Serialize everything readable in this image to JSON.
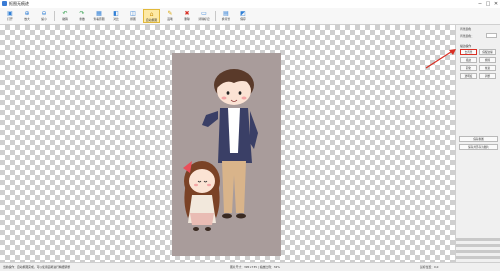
{
  "window": {
    "title": "抠图无痕迹",
    "minimize": "─",
    "maximize": "□",
    "close": "✕"
  },
  "toolbar": {
    "buttons": [
      {
        "label": "打开",
        "icon": "folder-icon"
      },
      {
        "label": "放大",
        "icon": "zoom-in-icon"
      },
      {
        "label": "缩小",
        "icon": "zoom-out-icon"
      },
      {
        "label": "撤销",
        "icon": "undo-icon"
      },
      {
        "label": "重做",
        "icon": "redo-icon"
      },
      {
        "label": "查看原图",
        "icon": "view-icon"
      },
      {
        "label": "对比",
        "icon": "compare-icon"
      },
      {
        "label": "抠图",
        "icon": "cut-icon"
      },
      {
        "label": "自动抠图",
        "icon": "auto-cut-icon"
      },
      {
        "label": "画笔",
        "icon": "brush-icon"
      },
      {
        "label": "删除",
        "icon": "delete-icon"
      },
      {
        "label": "清除标记",
        "icon": "clear-icon"
      },
      {
        "label": "换背景",
        "icon": "background-icon"
      },
      {
        "label": "保存",
        "icon": "save-icon"
      }
    ]
  },
  "panel": {
    "section1_title": "背景颜色",
    "color_label": "背景颜色：",
    "section2_title": "描边操作",
    "left_buttons": [
      "去背景",
      "描边",
      "羽化",
      "透明度"
    ],
    "right_buttons": [
      "保留边缘",
      "擦除",
      "恢复",
      "调整"
    ],
    "action1": "保存抠图",
    "action2": "保存并另存为图片"
  },
  "status": {
    "left": "当前操作：自动抠图完成，可以使用画笔进行精细调整",
    "mid": "图片尺寸：395×735 | 缩放比例：32%",
    "right": "鼠标位置：0,0"
  },
  "colors": {
    "accent": "#2f7fd6",
    "active": "#fde9a5",
    "annotation": "#d93025"
  }
}
